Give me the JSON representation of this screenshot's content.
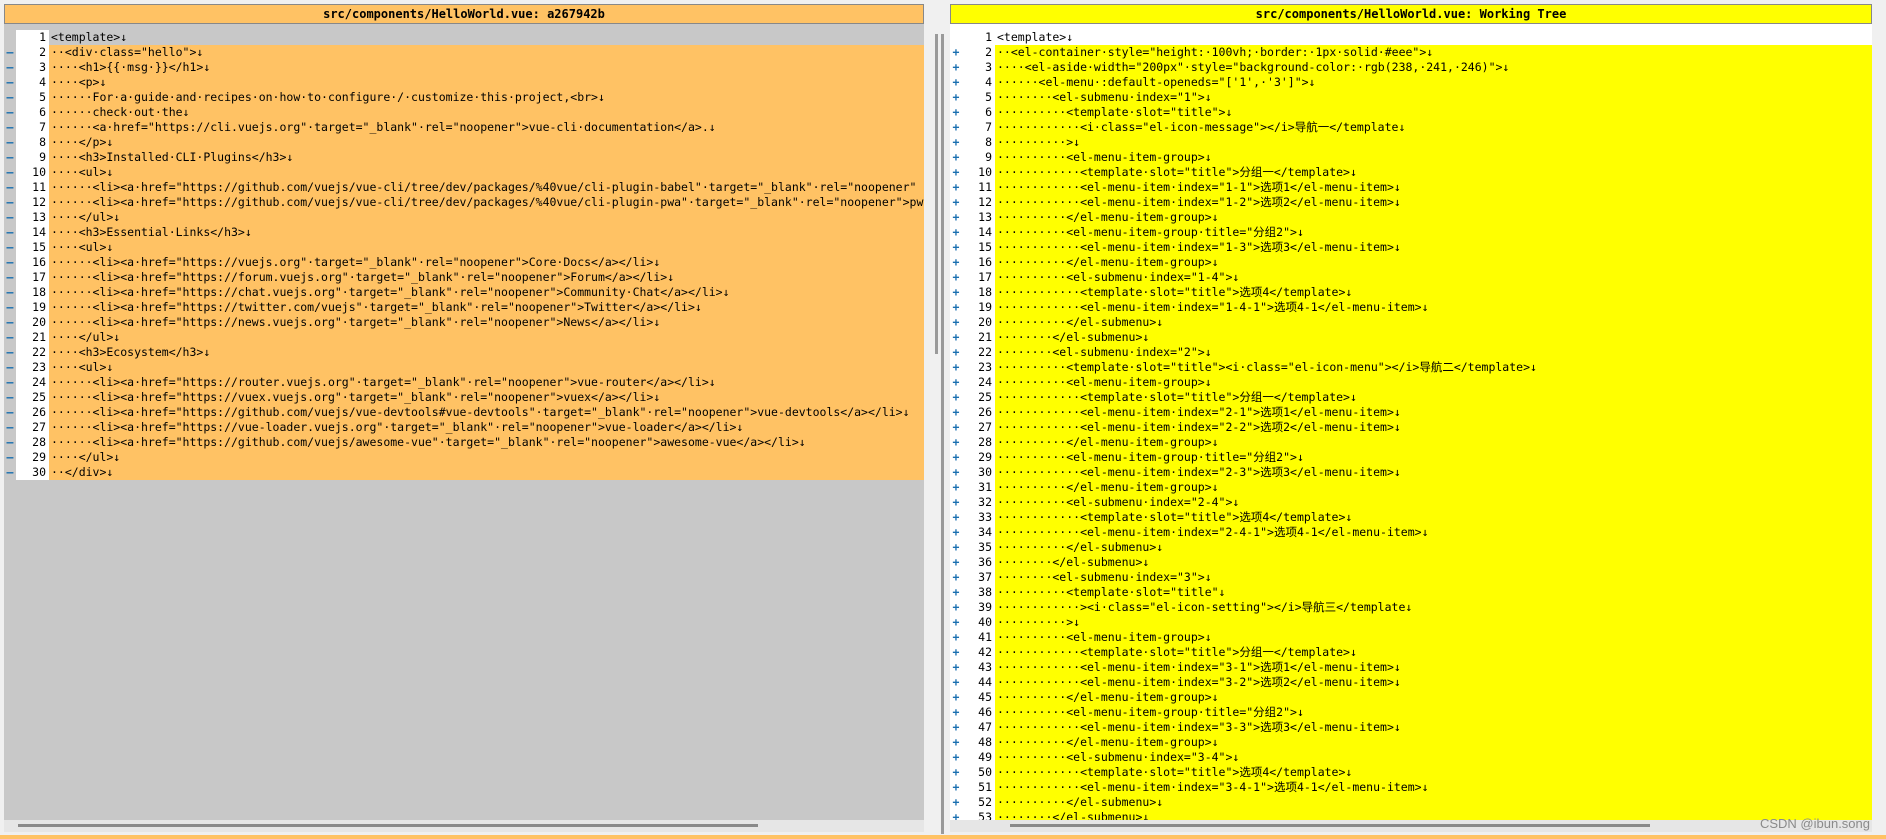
{
  "left_pane": {
    "title": "src/components/HelloWorld.vue: a267942b",
    "lines": [
      {
        "n": "1",
        "m": "",
        "t": "<template>↓",
        "c": false
      },
      {
        "n": "2",
        "m": "—",
        "t": "··<div·class=\"hello\">↓",
        "c": true
      },
      {
        "n": "3",
        "m": "—",
        "t": "····<h1>{{·msg·}}</h1>↓",
        "c": true
      },
      {
        "n": "4",
        "m": "—",
        "t": "····<p>↓",
        "c": true
      },
      {
        "n": "5",
        "m": "—",
        "t": "······For·a·guide·and·recipes·on·how·to·configure·/·customize·this·project,<br>↓",
        "c": true
      },
      {
        "n": "6",
        "m": "—",
        "t": "······check·out·the↓",
        "c": true
      },
      {
        "n": "7",
        "m": "—",
        "t": "······<a·href=\"https://cli.vuejs.org\"·target=\"_blank\"·rel=\"noopener\">vue-cli·documentation</a>.↓",
        "c": true
      },
      {
        "n": "8",
        "m": "—",
        "t": "····</p>↓",
        "c": true
      },
      {
        "n": "9",
        "m": "—",
        "t": "····<h3>Installed·CLI·Plugins</h3>↓",
        "c": true
      },
      {
        "n": "10",
        "m": "—",
        "t": "····<ul>↓",
        "c": true
      },
      {
        "n": "11",
        "m": "—",
        "t": "······<li><a·href=\"https://github.com/vuejs/vue-cli/tree/dev/packages/%40vue/cli-plugin-babel\"·target=\"_blank\"·rel=\"noopener\"",
        "c": true
      },
      {
        "n": "12",
        "m": "—",
        "t": "······<li><a·href=\"https://github.com/vuejs/vue-cli/tree/dev/packages/%40vue/cli-plugin-pwa\"·target=\"_blank\"·rel=\"noopener\">pw",
        "c": true
      },
      {
        "n": "13",
        "m": "—",
        "t": "····</ul>↓",
        "c": true
      },
      {
        "n": "14",
        "m": "—",
        "t": "····<h3>Essential·Links</h3>↓",
        "c": true
      },
      {
        "n": "15",
        "m": "—",
        "t": "····<ul>↓",
        "c": true
      },
      {
        "n": "16",
        "m": "—",
        "t": "······<li><a·href=\"https://vuejs.org\"·target=\"_blank\"·rel=\"noopener\">Core·Docs</a></li>↓",
        "c": true
      },
      {
        "n": "17",
        "m": "—",
        "t": "······<li><a·href=\"https://forum.vuejs.org\"·target=\"_blank\"·rel=\"noopener\">Forum</a></li>↓",
        "c": true
      },
      {
        "n": "18",
        "m": "—",
        "t": "······<li><a·href=\"https://chat.vuejs.org\"·target=\"_blank\"·rel=\"noopener\">Community·Chat</a></li>↓",
        "c": true
      },
      {
        "n": "19",
        "m": "—",
        "t": "······<li><a·href=\"https://twitter.com/vuejs\"·target=\"_blank\"·rel=\"noopener\">Twitter</a></li>↓",
        "c": true
      },
      {
        "n": "20",
        "m": "—",
        "t": "······<li><a·href=\"https://news.vuejs.org\"·target=\"_blank\"·rel=\"noopener\">News</a></li>↓",
        "c": true
      },
      {
        "n": "21",
        "m": "—",
        "t": "····</ul>↓",
        "c": true
      },
      {
        "n": "22",
        "m": "—",
        "t": "····<h3>Ecosystem</h3>↓",
        "c": true
      },
      {
        "n": "23",
        "m": "—",
        "t": "····<ul>↓",
        "c": true
      },
      {
        "n": "24",
        "m": "—",
        "t": "······<li><a·href=\"https://router.vuejs.org\"·target=\"_blank\"·rel=\"noopener\">vue-router</a></li>↓",
        "c": true
      },
      {
        "n": "25",
        "m": "—",
        "t": "······<li><a·href=\"https://vuex.vuejs.org\"·target=\"_blank\"·rel=\"noopener\">vuex</a></li>↓",
        "c": true
      },
      {
        "n": "26",
        "m": "—",
        "t": "······<li><a·href=\"https://github.com/vuejs/vue-devtools#vue-devtools\"·target=\"_blank\"·rel=\"noopener\">vue-devtools</a></li>↓",
        "c": true
      },
      {
        "n": "27",
        "m": "—",
        "t": "······<li><a·href=\"https://vue-loader.vuejs.org\"·target=\"_blank\"·rel=\"noopener\">vue-loader</a></li>↓",
        "c": true
      },
      {
        "n": "28",
        "m": "—",
        "t": "······<li><a·href=\"https://github.com/vuejs/awesome-vue\"·target=\"_blank\"·rel=\"noopener\">awesome-vue</a></li>↓",
        "c": true
      },
      {
        "n": "29",
        "m": "—",
        "t": "····</ul>↓",
        "c": true
      },
      {
        "n": "30",
        "m": "—",
        "t": "··</div>↓",
        "c": true
      }
    ]
  },
  "right_pane": {
    "title": "src/components/HelloWorld.vue: Working Tree",
    "lines": [
      {
        "n": "1",
        "m": "",
        "t": "<template>↓",
        "c": false
      },
      {
        "n": "2",
        "m": "+",
        "t": "··<el-container·style=\"height:·100vh;·border:·1px·solid·#eee\">↓",
        "c": true
      },
      {
        "n": "3",
        "m": "+",
        "t": "····<el-aside·width=\"200px\"·style=\"background-color:·rgb(238,·241,·246)\">↓",
        "c": true
      },
      {
        "n": "4",
        "m": "+",
        "t": "······<el-menu·:default-openeds=\"['1',·'3']\">↓",
        "c": true
      },
      {
        "n": "5",
        "m": "+",
        "t": "········<el-submenu·index=\"1\">↓",
        "c": true
      },
      {
        "n": "6",
        "m": "+",
        "t": "··········<template·slot=\"title\">↓",
        "c": true
      },
      {
        "n": "7",
        "m": "+",
        "t": "············<i·class=\"el-icon-message\"></i>导航一</template↓",
        "c": true
      },
      {
        "n": "8",
        "m": "+",
        "t": "··········>↓",
        "c": true
      },
      {
        "n": "9",
        "m": "+",
        "t": "··········<el-menu-item-group>↓",
        "c": true
      },
      {
        "n": "10",
        "m": "+",
        "t": "············<template·slot=\"title\">分组一</template>↓",
        "c": true
      },
      {
        "n": "11",
        "m": "+",
        "t": "············<el-menu-item·index=\"1-1\">选项1</el-menu-item>↓",
        "c": true
      },
      {
        "n": "12",
        "m": "+",
        "t": "············<el-menu-item·index=\"1-2\">选项2</el-menu-item>↓",
        "c": true
      },
      {
        "n": "13",
        "m": "+",
        "t": "··········</el-menu-item-group>↓",
        "c": true
      },
      {
        "n": "14",
        "m": "+",
        "t": "··········<el-menu-item-group·title=\"分组2\">↓",
        "c": true
      },
      {
        "n": "15",
        "m": "+",
        "t": "············<el-menu-item·index=\"1-3\">选项3</el-menu-item>↓",
        "c": true
      },
      {
        "n": "16",
        "m": "+",
        "t": "··········</el-menu-item-group>↓",
        "c": true
      },
      {
        "n": "17",
        "m": "+",
        "t": "··········<el-submenu·index=\"1-4\">↓",
        "c": true
      },
      {
        "n": "18",
        "m": "+",
        "t": "············<template·slot=\"title\">选项4</template>↓",
        "c": true
      },
      {
        "n": "19",
        "m": "+",
        "t": "············<el-menu-item·index=\"1-4-1\">选项4-1</el-menu-item>↓",
        "c": true
      },
      {
        "n": "20",
        "m": "+",
        "t": "··········</el-submenu>↓",
        "c": true
      },
      {
        "n": "21",
        "m": "+",
        "t": "········</el-submenu>↓",
        "c": true
      },
      {
        "n": "22",
        "m": "+",
        "t": "········<el-submenu·index=\"2\">↓",
        "c": true
      },
      {
        "n": "23",
        "m": "+",
        "t": "··········<template·slot=\"title\"><i·class=\"el-icon-menu\"></i>导航二</template>↓",
        "c": true
      },
      {
        "n": "24",
        "m": "+",
        "t": "··········<el-menu-item-group>↓",
        "c": true
      },
      {
        "n": "25",
        "m": "+",
        "t": "············<template·slot=\"title\">分组一</template>↓",
        "c": true
      },
      {
        "n": "26",
        "m": "+",
        "t": "············<el-menu-item·index=\"2-1\">选项1</el-menu-item>↓",
        "c": true
      },
      {
        "n": "27",
        "m": "+",
        "t": "············<el-menu-item·index=\"2-2\">选项2</el-menu-item>↓",
        "c": true
      },
      {
        "n": "28",
        "m": "+",
        "t": "··········</el-menu-item-group>↓",
        "c": true
      },
      {
        "n": "29",
        "m": "+",
        "t": "··········<el-menu-item-group·title=\"分组2\">↓",
        "c": true
      },
      {
        "n": "30",
        "m": "+",
        "t": "············<el-menu-item·index=\"2-3\">选项3</el-menu-item>↓",
        "c": true
      },
      {
        "n": "31",
        "m": "+",
        "t": "··········</el-menu-item-group>↓",
        "c": true
      },
      {
        "n": "32",
        "m": "+",
        "t": "··········<el-submenu·index=\"2-4\">↓",
        "c": true
      },
      {
        "n": "33",
        "m": "+",
        "t": "············<template·slot=\"title\">选项4</template>↓",
        "c": true
      },
      {
        "n": "34",
        "m": "+",
        "t": "············<el-menu-item·index=\"2-4-1\">选项4-1</el-menu-item>↓",
        "c": true
      },
      {
        "n": "35",
        "m": "+",
        "t": "··········</el-submenu>↓",
        "c": true
      },
      {
        "n": "36",
        "m": "+",
        "t": "········</el-submenu>↓",
        "c": true
      },
      {
        "n": "37",
        "m": "+",
        "t": "········<el-submenu·index=\"3\">↓",
        "c": true
      },
      {
        "n": "38",
        "m": "+",
        "t": "··········<template·slot=\"title\"↓",
        "c": true
      },
      {
        "n": "39",
        "m": "+",
        "t": "············><i·class=\"el-icon-setting\"></i>导航三</template↓",
        "c": true
      },
      {
        "n": "40",
        "m": "+",
        "t": "··········>↓",
        "c": true
      },
      {
        "n": "41",
        "m": "+",
        "t": "··········<el-menu-item-group>↓",
        "c": true
      },
      {
        "n": "42",
        "m": "+",
        "t": "············<template·slot=\"title\">分组一</template>↓",
        "c": true
      },
      {
        "n": "43",
        "m": "+",
        "t": "············<el-menu-item·index=\"3-1\">选项1</el-menu-item>↓",
        "c": true
      },
      {
        "n": "44",
        "m": "+",
        "t": "············<el-menu-item·index=\"3-2\">选项2</el-menu-item>↓",
        "c": true
      },
      {
        "n": "45",
        "m": "+",
        "t": "··········</el-menu-item-group>↓",
        "c": true
      },
      {
        "n": "46",
        "m": "+",
        "t": "··········<el-menu-item-group·title=\"分组2\">↓",
        "c": true
      },
      {
        "n": "47",
        "m": "+",
        "t": "············<el-menu-item·index=\"3-3\">选项3</el-menu-item>↓",
        "c": true
      },
      {
        "n": "48",
        "m": "+",
        "t": "··········</el-menu-item-group>↓",
        "c": true
      },
      {
        "n": "49",
        "m": "+",
        "t": "··········<el-submenu·index=\"3-4\">↓",
        "c": true
      },
      {
        "n": "50",
        "m": "+",
        "t": "············<template·slot=\"title\">选项4</template>↓",
        "c": true
      },
      {
        "n": "51",
        "m": "+",
        "t": "············<el-menu-item·index=\"3-4-1\">选项4-1</el-menu-item>↓",
        "c": true
      },
      {
        "n": "52",
        "m": "+",
        "t": "··········</el-submenu>↓",
        "c": true
      },
      {
        "n": "53",
        "m": "+",
        "t": "········</el-submenu>↓",
        "c": true
      }
    ]
  },
  "watermark": "CSDN @ibun.song",
  "colors": {
    "left_changed": "#ffc264",
    "right_changed": "#ffff00",
    "unchanged_bg": "#c8c8c8",
    "marker": "#1a6fb0"
  }
}
